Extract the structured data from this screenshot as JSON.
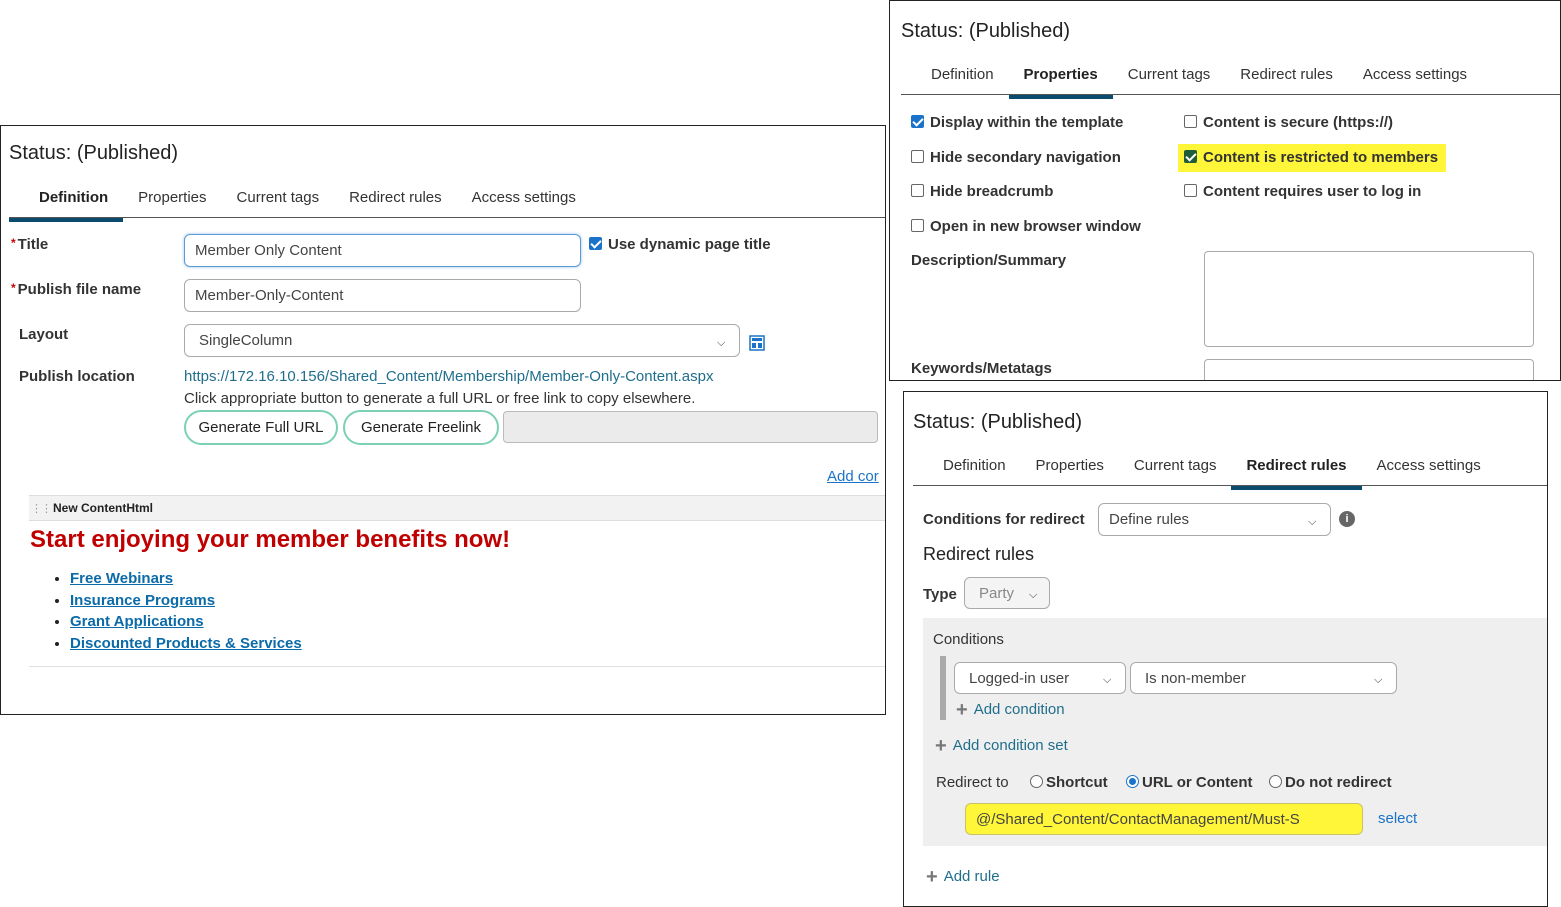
{
  "definition_panel": {
    "status": "Status: (Published)",
    "tabs": [
      "Definition",
      "Properties",
      "Current tags",
      "Redirect rules",
      "Access settings"
    ],
    "active_tab": "Definition",
    "title_label": "Title",
    "title_value": "Member Only Content",
    "use_dynamic_label": "Use dynamic page title",
    "publish_file_label": "Publish file name",
    "publish_file_value": "Member-Only-Content",
    "layout_label": "Layout",
    "layout_value": "SingleColumn",
    "publish_location_label": "Publish location",
    "publish_location_url": "https://172.16.10.156/Shared_Content/Membership/Member-Only-Content.aspx",
    "help_text": "Click appropriate button to generate a full URL or free link to copy elsewhere.",
    "generate_full_url": "Generate Full URL",
    "generate_freelink": "Generate Freelink",
    "add_content_link": "Add cor",
    "content_block_title": "New ContentHtml",
    "headline": "Start enjoying your member benefits now!",
    "benefits": [
      "Free Webinars",
      "Insurance Programs",
      "Grant Applications",
      "Discounted Products & Services"
    ]
  },
  "properties_panel": {
    "status": "Status: (Published)",
    "tabs": [
      "Definition",
      "Properties",
      "Current tags",
      "Redirect rules",
      "Access settings"
    ],
    "active_tab": "Properties",
    "display_within_template": "Display within the template",
    "content_is_secure": "Content is secure (https://)",
    "hide_secondary_nav": "Hide secondary navigation",
    "content_restricted": "Content is restricted to members",
    "hide_breadcrumb": "Hide breadcrumb",
    "content_requires_login": "Content requires user to log in",
    "open_new_window": "Open in new browser window",
    "description_label": "Description/Summary",
    "keywords_label": "Keywords/Metatags"
  },
  "redirect_panel": {
    "status": "Status: (Published)",
    "tabs": [
      "Definition",
      "Properties",
      "Current tags",
      "Redirect rules",
      "Access settings"
    ],
    "active_tab": "Redirect rules",
    "conditions_for_redirect_label": "Conditions for redirect",
    "conditions_for_redirect_value": "Define rules",
    "redirect_rules_heading": "Redirect rules",
    "type_label": "Type",
    "type_value": "Party",
    "conditions_label": "Conditions",
    "condition_field": "Logged-in user",
    "condition_operator": "Is non-member",
    "add_condition": "Add condition",
    "add_condition_set": "Add condition set",
    "redirect_to_label": "Redirect to",
    "option_shortcut": "Shortcut",
    "option_url": "URL or Content",
    "option_no_redirect": "Do not redirect",
    "redirect_target": "@/Shared_Content/ContactManagement/Must-S",
    "select_link": "select",
    "add_rule": "Add rule"
  },
  "colors": {
    "active_tab_underline": "#0b4b6e",
    "headline_red": "#c00000",
    "highlight_yellow": "#fff63a",
    "button_outline": "#7bd0b5",
    "link_blue": "#0b6aa8"
  }
}
